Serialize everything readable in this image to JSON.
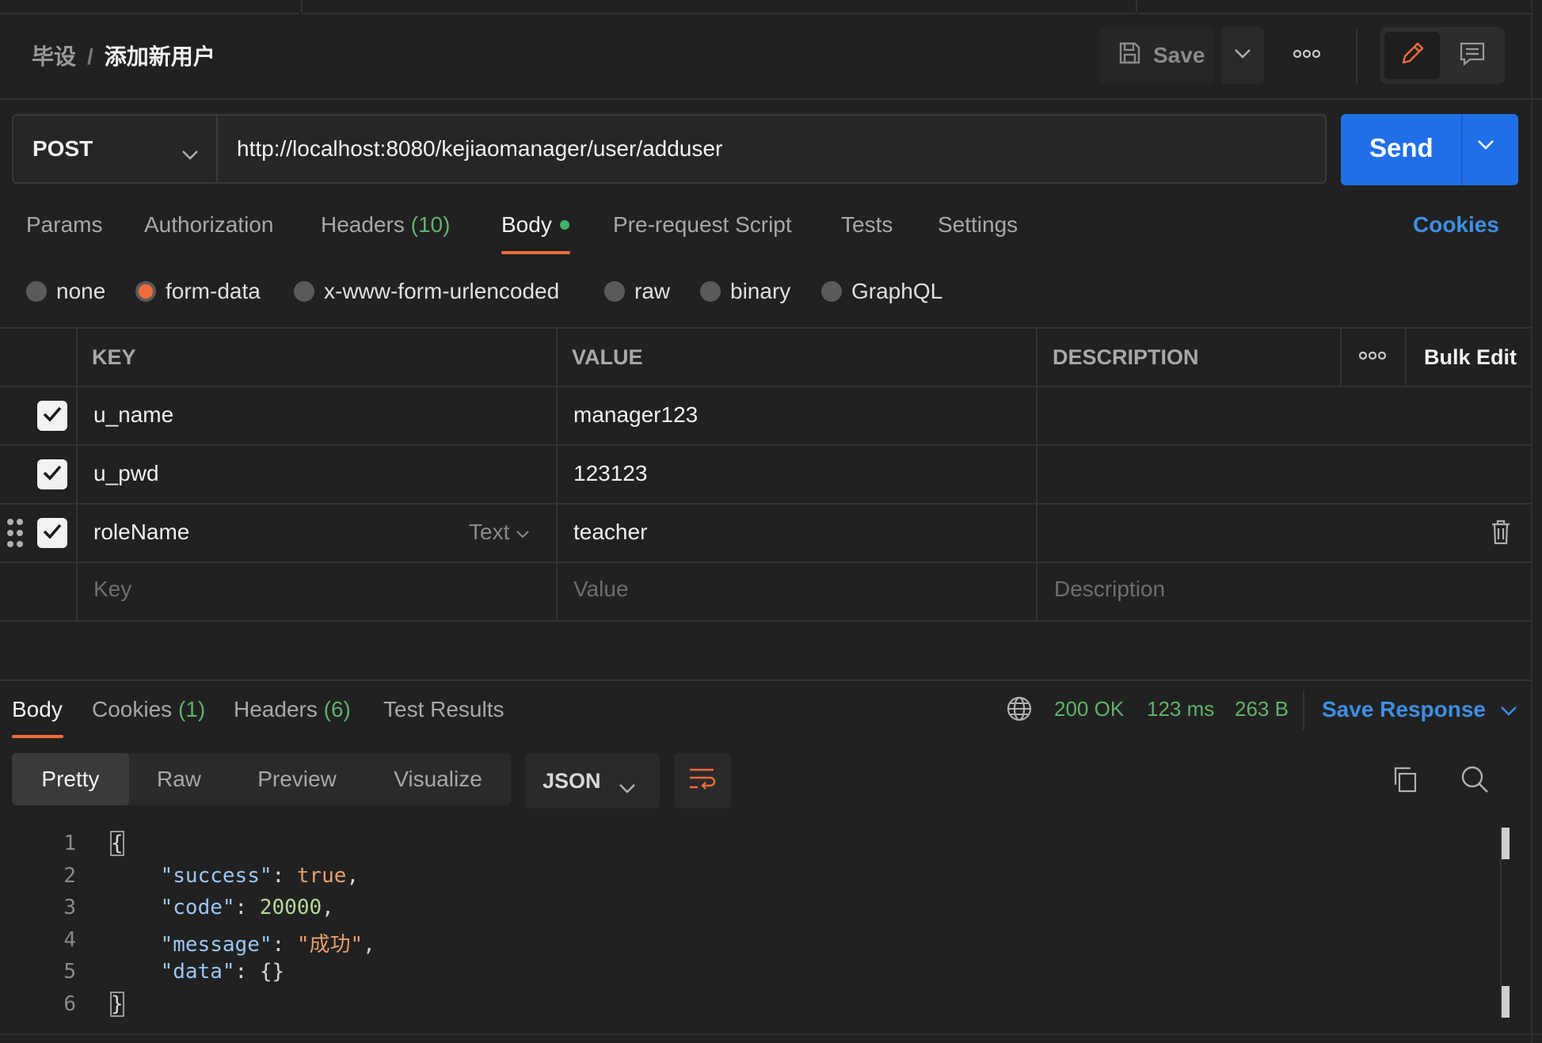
{
  "breadcrumb": {
    "parent": "毕设",
    "separator": "/",
    "current": "添加新用户"
  },
  "toolbar": {
    "save_label": "Save"
  },
  "request": {
    "method": "POST",
    "url": "http://localhost:8080/kejiaomanager/user/adduser",
    "send_label": "Send"
  },
  "req_tabs": {
    "params": "Params",
    "authorization": "Authorization",
    "headers": "Headers",
    "headers_count": "(10)",
    "body": "Body",
    "prerequest": "Pre-request Script",
    "tests": "Tests",
    "settings": "Settings",
    "cookies": "Cookies"
  },
  "body_types": {
    "none": "none",
    "form_data": "form-data",
    "urlencoded": "x-www-form-urlencoded",
    "raw": "raw",
    "binary": "binary",
    "graphql": "GraphQL",
    "selected": "form-data"
  },
  "table": {
    "headers": {
      "key": "KEY",
      "value": "VALUE",
      "description": "DESCRIPTION",
      "bulk_edit": "Bulk Edit"
    },
    "rows": [
      {
        "key": "u_name",
        "value": "manager123",
        "checked": true
      },
      {
        "key": "u_pwd",
        "value": "123123",
        "checked": true
      },
      {
        "key": "roleName",
        "value": "teacher",
        "checked": true,
        "type": "Text"
      }
    ],
    "placeholders": {
      "key": "Key",
      "value": "Value",
      "description": "Description"
    }
  },
  "response": {
    "tabs": {
      "body": "Body",
      "cookies": "Cookies",
      "cookies_count": "(1)",
      "headers": "Headers",
      "headers_count": "(6)",
      "test_results": "Test Results"
    },
    "status": "200 OK",
    "time": "123 ms",
    "size": "263 B",
    "save_response": "Save Response",
    "views": {
      "pretty": "Pretty",
      "raw": "Raw",
      "preview": "Preview",
      "visualize": "Visualize"
    },
    "format": "JSON",
    "code": {
      "line_numbers": [
        "1",
        "2",
        "3",
        "4",
        "5",
        "6"
      ],
      "open_brace": "{",
      "close_brace": "}",
      "k_success": "\"success\"",
      "v_success": "true",
      "k_code": "\"code\"",
      "v_code": "20000",
      "k_message": "\"message\"",
      "v_message": "\"成功\"",
      "k_data": "\"data\"",
      "v_data": "{}"
    }
  },
  "colors": {
    "accent_orange": "#ef6c3a",
    "send_blue": "#1f70e8",
    "link_blue": "#3d8fe5",
    "success_green": "#5fb26a",
    "background": "#212121"
  }
}
